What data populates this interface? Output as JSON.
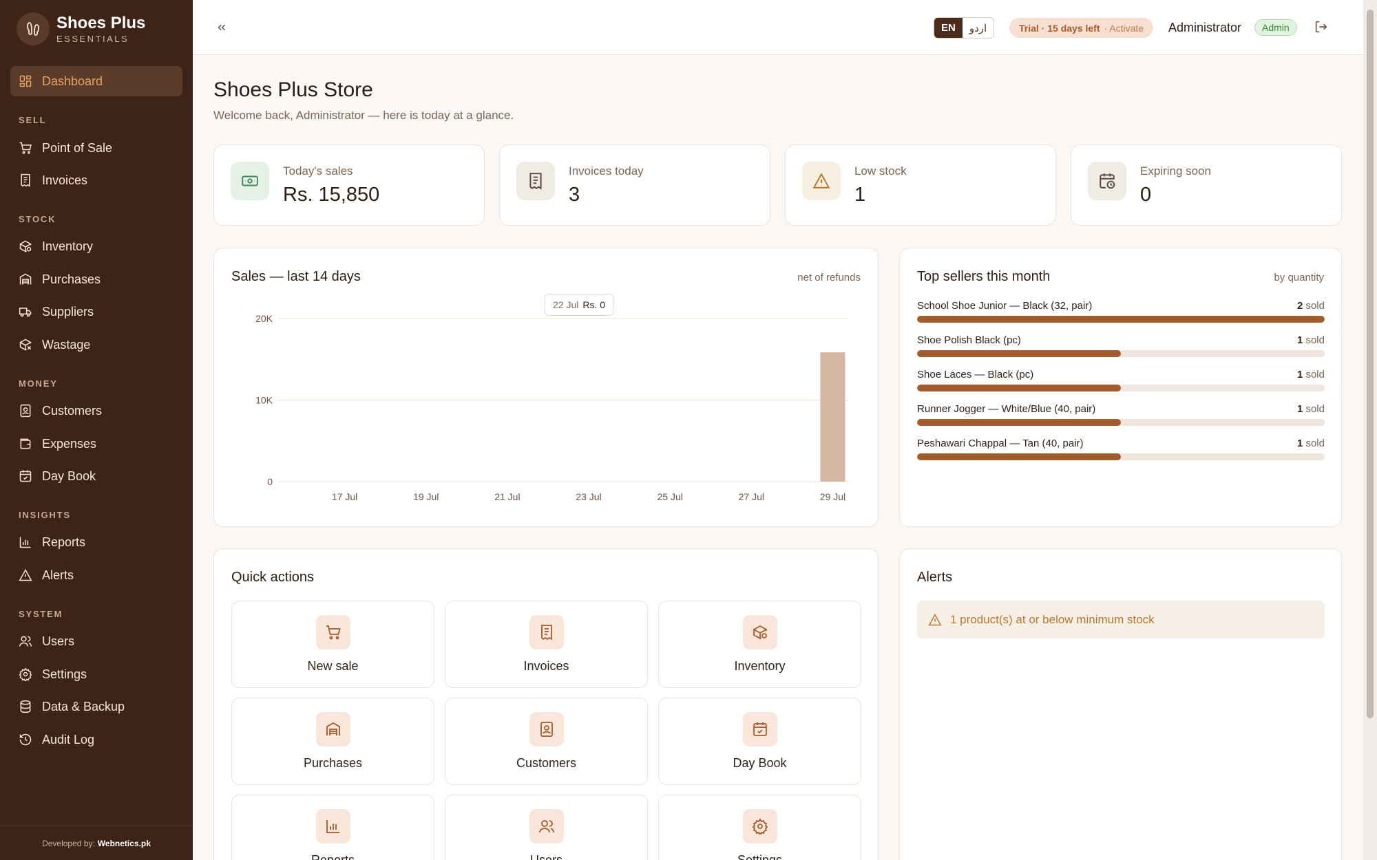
{
  "brand": {
    "name": "Shoes Plus",
    "subtitle": "ESSENTIALS"
  },
  "sidebar": {
    "sections": {
      "sell": "SELL",
      "stock": "STOCK",
      "money": "MONEY",
      "insights": "INSIGHTS",
      "system": "SYSTEM"
    },
    "items": {
      "dashboard": "Dashboard",
      "pos": "Point of Sale",
      "invoices": "Invoices",
      "inventory": "Inventory",
      "purchases": "Purchases",
      "suppliers": "Suppliers",
      "wastage": "Wastage",
      "customers": "Customers",
      "expenses": "Expenses",
      "daybook": "Day Book",
      "reports": "Reports",
      "alerts": "Alerts",
      "users": "Users",
      "settings": "Settings",
      "backup": "Data & Backup",
      "audit": "Audit Log"
    },
    "footer_prefix": "Developed by:",
    "footer_brand": "Webnetics.pk"
  },
  "topbar": {
    "lang_en": "EN",
    "lang_ur": "اردو",
    "trial_text": "Trial · 15 days left",
    "trial_action": "· Activate",
    "user_name": "Administrator",
    "role": "Admin"
  },
  "page": {
    "title": "Shoes Plus Store",
    "subtitle": "Welcome back, Administrator — here is today at a glance."
  },
  "stats": {
    "sales": {
      "label": "Today's sales",
      "value": "Rs. 15,850"
    },
    "invoices": {
      "label": "Invoices today",
      "value": "3"
    },
    "low_stock": {
      "label": "Low stock",
      "value": "1"
    },
    "expiring": {
      "label": "Expiring soon",
      "value": "0"
    }
  },
  "sales_card": {
    "title": "Sales — last 14 days",
    "note": "net of refunds",
    "tooltip_date": "22 Jul",
    "tooltip_value": "Rs. 0"
  },
  "chart_data": {
    "type": "bar",
    "categories": [
      "16 Jul",
      "17 Jul",
      "18 Jul",
      "19 Jul",
      "20 Jul",
      "21 Jul",
      "22 Jul",
      "23 Jul",
      "24 Jul",
      "25 Jul",
      "26 Jul",
      "27 Jul",
      "28 Jul",
      "29 Jul"
    ],
    "tick_labels": [
      "17 Jul",
      "19 Jul",
      "21 Jul",
      "23 Jul",
      "25 Jul",
      "27 Jul",
      "29 Jul"
    ],
    "values": [
      0,
      0,
      0,
      0,
      0,
      0,
      0,
      0,
      0,
      0,
      0,
      0,
      0,
      15850
    ],
    "yticks": [
      "0",
      "10K",
      "20K"
    ],
    "ylim": [
      0,
      20000
    ],
    "bar_color": "#d4b6a1"
  },
  "top_sellers": {
    "title": "Top sellers this month",
    "note": "by quantity",
    "sold_word": "sold",
    "items": [
      {
        "name": "School Shoe Junior — Black (32, pair)",
        "qty": "2",
        "fraction": 1.0
      },
      {
        "name": "Shoe Polish Black (pc)",
        "qty": "1",
        "fraction": 0.5
      },
      {
        "name": "Shoe Laces — Black (pc)",
        "qty": "1",
        "fraction": 0.5
      },
      {
        "name": "Runner Jogger — White/Blue (40, pair)",
        "qty": "1",
        "fraction": 0.5
      },
      {
        "name": "Peshawari Chappal — Tan (40, pair)",
        "qty": "1",
        "fraction": 0.5
      }
    ]
  },
  "quick_actions": {
    "title": "Quick actions",
    "items": [
      "New sale",
      "Invoices",
      "Inventory",
      "Purchases",
      "Customers",
      "Day Book",
      "Reports",
      "Users",
      "Settings"
    ]
  },
  "alerts_card": {
    "title": "Alerts",
    "message": "1 product(s) at or below minimum stock"
  }
}
